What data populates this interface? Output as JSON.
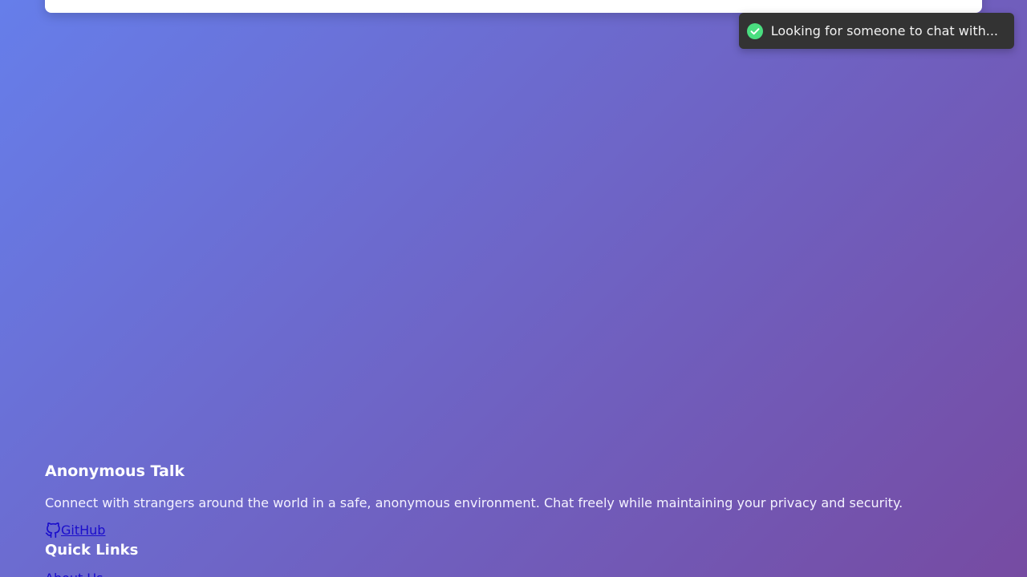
{
  "toast": {
    "icon": "check-circle-icon",
    "icon_color": "#4ade80",
    "message": "Looking for someone to chat with..."
  },
  "footer": {
    "title": "Anonymous Talk",
    "description": "Connect with strangers around the world in a safe, anonymous environment. Chat freely while maintaining your privacy and security.",
    "github": {
      "icon": "github-icon",
      "label": "GitHub"
    },
    "quick_links": {
      "title": "Quick Links",
      "items": [
        {
          "label": "About Us"
        }
      ]
    }
  },
  "colors": {
    "background_start": "#667eea",
    "background_end": "#764ba2",
    "toast_bg": "#333333",
    "link": "#1a0dcc"
  }
}
